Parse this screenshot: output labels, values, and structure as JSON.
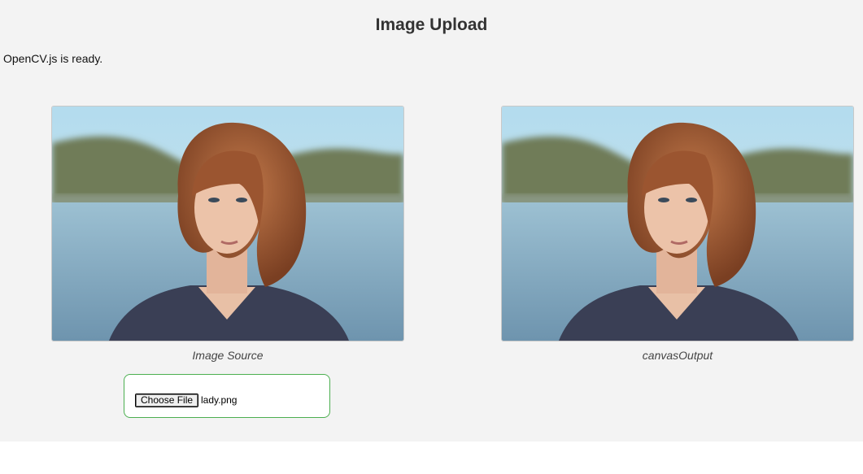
{
  "page": {
    "title": "Image Upload",
    "status": "OpenCV.js is ready."
  },
  "source_panel": {
    "caption": "Image Source",
    "image_alt": "portrait of a woman with auburn bob hair in front of a lake and hills"
  },
  "output_panel": {
    "caption": "canvasOutput"
  },
  "file_input": {
    "button_label": "Choose File",
    "file_name": "lady.png"
  },
  "colors": {
    "background": "#f3f3f3",
    "file_box_border": "#4caf50",
    "title": "#333333"
  }
}
